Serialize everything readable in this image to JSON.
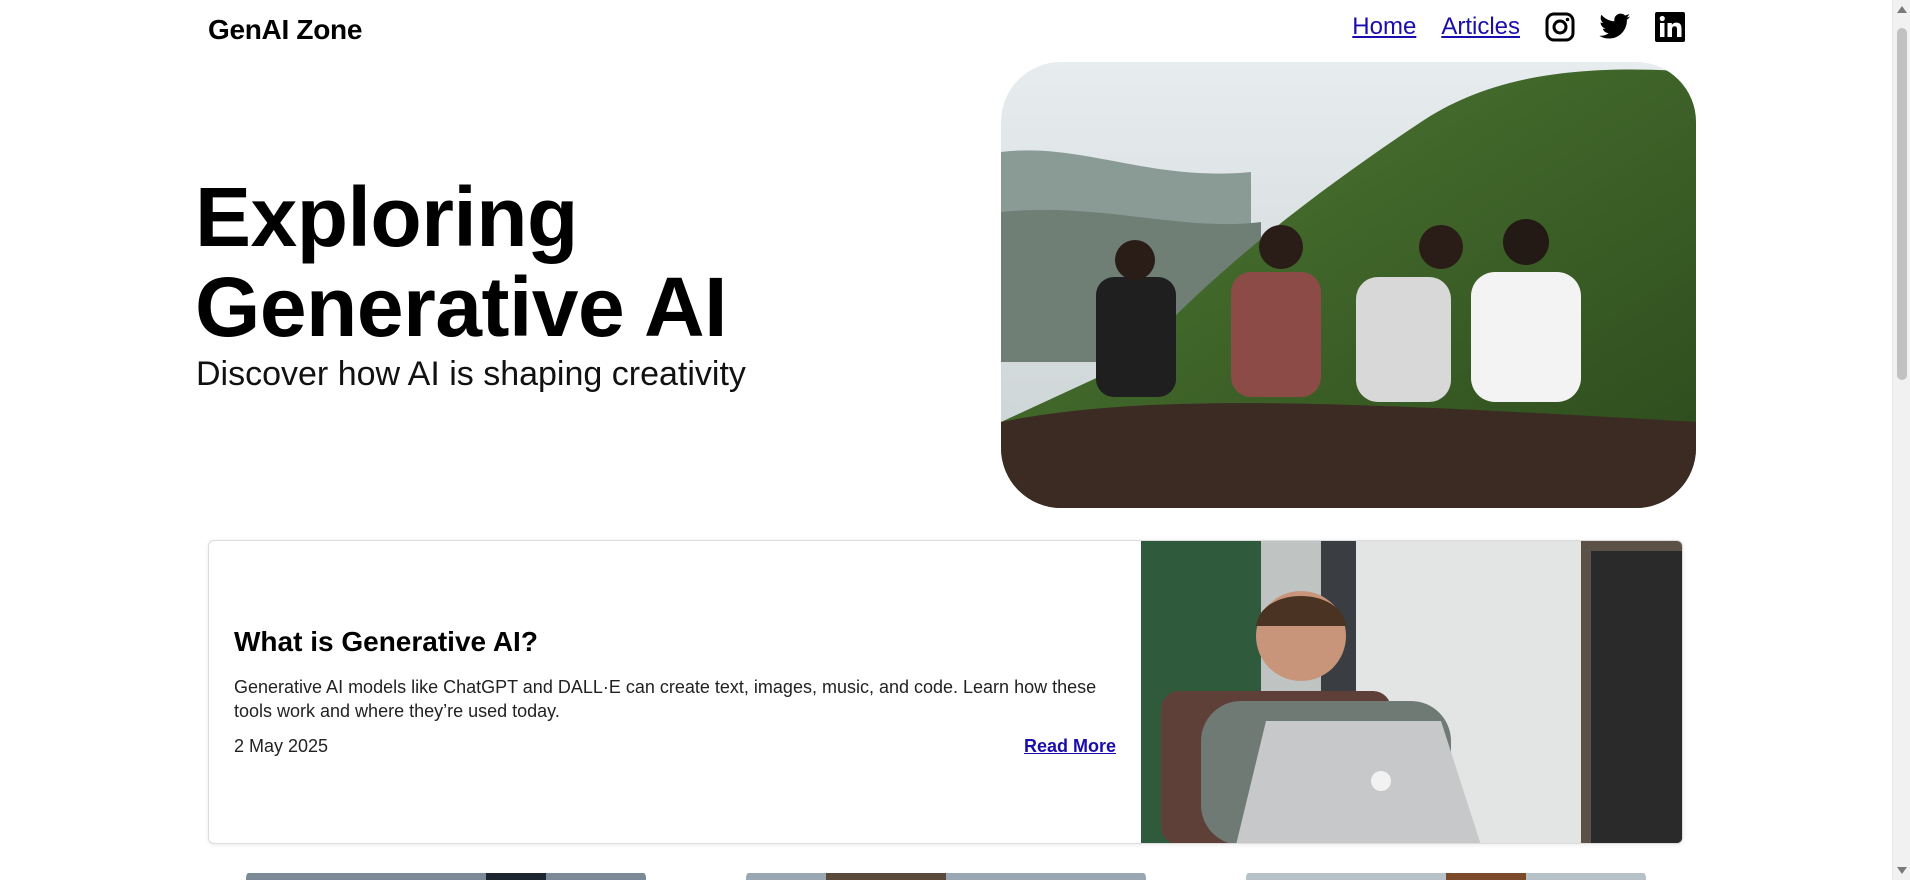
{
  "header": {
    "brand": "GenAI Zone",
    "nav": [
      {
        "label": "Home"
      },
      {
        "label": "Articles"
      }
    ],
    "social_icons": [
      "instagram-icon",
      "twitter-icon",
      "linkedin-icon"
    ]
  },
  "hero": {
    "title": "Exploring Generative AI",
    "subtitle": "Discover how AI is shaping creativity"
  },
  "featured_article": {
    "title": "What is Generative AI?",
    "description": "Generative AI models like ChatGPT and DALL·E can create text, images, music, and code. Learn how these tools work and where they’re used today.",
    "date": "2 May 2025",
    "read_more": "Read More"
  },
  "colors": {
    "link": "#1a0dab",
    "text": "#000000",
    "card_border": "#dcdcdc"
  }
}
